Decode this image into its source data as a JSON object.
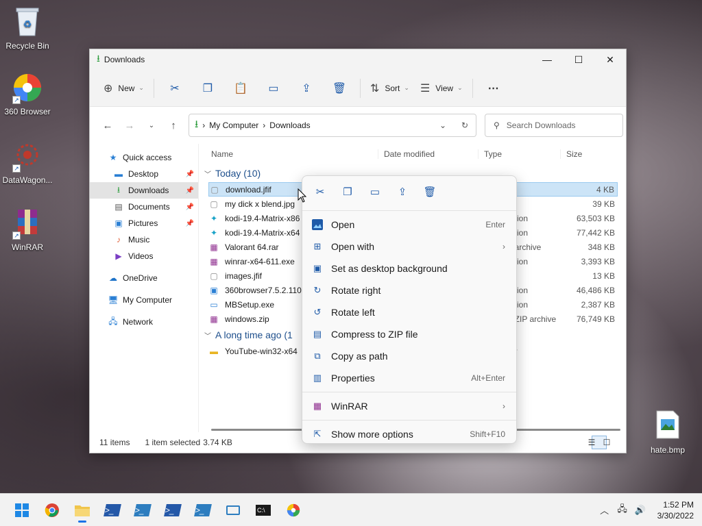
{
  "desktop": {
    "icons": [
      {
        "label": "Recycle Bin",
        "icon": "recycle-bin-icon"
      },
      {
        "label": "360 Browser",
        "icon": "360-browser-icon"
      },
      {
        "label": "DataWagon...",
        "icon": "datawagon-icon"
      },
      {
        "label": "WinRAR",
        "icon": "winrar-icon"
      },
      {
        "label": "hate.bmp",
        "icon": "image-file-icon"
      }
    ]
  },
  "window": {
    "title": "Downloads",
    "toolbar": {
      "new": "New",
      "sort": "Sort",
      "view": "View"
    },
    "address": {
      "root": "My Computer",
      "current": "Downloads"
    },
    "search_placeholder": "Search Downloads"
  },
  "nav": {
    "items": [
      {
        "label": "Quick access"
      },
      {
        "label": "Desktop"
      },
      {
        "label": "Downloads"
      },
      {
        "label": "Documents"
      },
      {
        "label": "Pictures"
      },
      {
        "label": "Music"
      },
      {
        "label": "Videos"
      },
      {
        "label": "OneDrive"
      },
      {
        "label": "My Computer"
      },
      {
        "label": "Network"
      }
    ]
  },
  "columns": {
    "name": "Name",
    "date": "Date modified",
    "type": "Type",
    "size": "Size"
  },
  "groups": {
    "today": "Today (10)",
    "long_ago": "A long time ago (1"
  },
  "files": [
    {
      "name": "download.jfif",
      "type": "",
      "size": "4 KB"
    },
    {
      "name": "my dick x blend.jpg",
      "type": "",
      "size": "39 KB"
    },
    {
      "name": "kodi-19.4-Matrix-x86",
      "type": "ation",
      "size": "63,503 KB"
    },
    {
      "name": "kodi-19.4-Matrix-x64",
      "type": "ation",
      "size": "77,442 KB"
    },
    {
      "name": "Valorant 64.rar",
      "type": ". archive",
      "size": "348 KB"
    },
    {
      "name": "winrar-x64-611.exe",
      "type": "ation",
      "size": "3,393 KB"
    },
    {
      "name": "images.jfif",
      "type": "",
      "size": "13 KB"
    },
    {
      "name": "360browser7.5.2.110.e",
      "type": "ation",
      "size": "46,486 KB"
    },
    {
      "name": "MBSetup.exe",
      "type": "ation",
      "size": "2,387 KB"
    },
    {
      "name": "windows.zip",
      "type": ". ZIP archive",
      "size": "76,749 KB"
    },
    {
      "name": "YouTube-win32-x64",
      "type": "er",
      "size": ""
    }
  ],
  "status": {
    "count": "11 items",
    "selected": "1 item selected",
    "size": "3.74 KB"
  },
  "context_menu": {
    "items": [
      {
        "label": "Open",
        "accel": "Enter"
      },
      {
        "label": "Open with",
        "accel": ""
      },
      {
        "label": "Set as desktop background",
        "accel": ""
      },
      {
        "label": "Rotate right",
        "accel": ""
      },
      {
        "label": "Rotate left",
        "accel": ""
      },
      {
        "label": "Compress to ZIP file",
        "accel": ""
      },
      {
        "label": "Copy as path",
        "accel": ""
      },
      {
        "label": "Properties",
        "accel": "Alt+Enter"
      },
      {
        "label": "WinRAR",
        "accel": ""
      },
      {
        "label": "Show more options",
        "accel": "Shift+F10"
      }
    ]
  },
  "taskbar": {
    "time": "1:52 PM",
    "date": "3/30/2022"
  }
}
